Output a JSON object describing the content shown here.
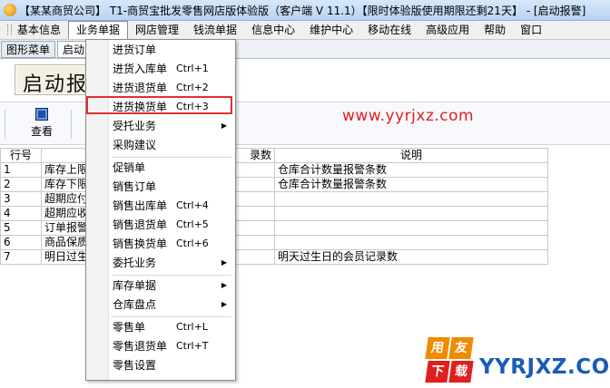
{
  "window": {
    "title": "【某某商贸公司】 T1-商贸宝批发零售网店版体验版（客户端 V 11.1）【限时体验版使用期限还剩21天】 - [启动报警]"
  },
  "menubar": {
    "items": [
      "基本信息",
      "业务单据",
      "网店管理",
      "钱流单据",
      "信息中心",
      "维护中心",
      "移动在线",
      "高级应用",
      "帮助",
      "窗口"
    ],
    "active_index": 1
  },
  "tabs": [
    "图形菜单",
    "启动"
  ],
  "banner": {
    "text": "启动报"
  },
  "toolbar": {
    "view_label": "查看"
  },
  "watermark": {
    "url": "www.yyrjxz.com"
  },
  "grid": {
    "headers": [
      "行号",
      "",
      "录数",
      "说明"
    ],
    "rows": [
      [
        "1",
        "库存上限",
        "",
        "仓库合计数量报警条数"
      ],
      [
        "2",
        "库存下限",
        "",
        "仓库合计数量报警条数"
      ],
      [
        "3",
        "超期应付",
        "",
        ""
      ],
      [
        "4",
        "超期应收",
        "",
        ""
      ],
      [
        "5",
        "订单报警",
        "",
        ""
      ],
      [
        "6",
        "商品保质",
        "",
        ""
      ],
      [
        "7",
        "明日过生",
        "",
        "明天过生日的会员记录数"
      ]
    ]
  },
  "dropdown": {
    "items": [
      {
        "label": "进货订单",
        "shortcut": "",
        "submenu": false
      },
      {
        "label": "进货入库单",
        "shortcut": "Ctrl+1",
        "submenu": false
      },
      {
        "label": "进货退货单",
        "shortcut": "Ctrl+2",
        "submenu": false
      },
      {
        "label": "进货换货单",
        "shortcut": "Ctrl+3",
        "submenu": false,
        "highlighted": true
      },
      {
        "label": "受托业务",
        "shortcut": "",
        "submenu": true
      },
      {
        "label": "采购建议",
        "shortcut": "",
        "submenu": false
      },
      {
        "label": "促销单",
        "shortcut": "",
        "submenu": false
      },
      {
        "label": "销售订单",
        "shortcut": "",
        "submenu": false
      },
      {
        "label": "销售出库单",
        "shortcut": "Ctrl+4",
        "submenu": false
      },
      {
        "label": "销售退货单",
        "shortcut": "Ctrl+5",
        "submenu": false
      },
      {
        "label": "销售换货单",
        "shortcut": "Ctrl+6",
        "submenu": false
      },
      {
        "label": "委托业务",
        "shortcut": "",
        "submenu": true
      },
      {
        "label": "库存单据",
        "shortcut": "",
        "submenu": true
      },
      {
        "label": "仓库盘点",
        "shortcut": "",
        "submenu": true
      },
      {
        "label": "零售单",
        "shortcut": "Ctrl+L",
        "submenu": false
      },
      {
        "label": "零售退货单",
        "shortcut": "Ctrl+T",
        "submenu": false
      },
      {
        "label": "零售设置",
        "shortcut": "",
        "submenu": false
      }
    ]
  },
  "logo": {
    "chars": [
      "用",
      "友",
      "下",
      "载"
    ],
    "text": "YYRJXZ.COM"
  },
  "colors": {
    "highlight_border": "#e03030",
    "watermark": "#e02020",
    "logo_blue": "#1a5bb8"
  }
}
